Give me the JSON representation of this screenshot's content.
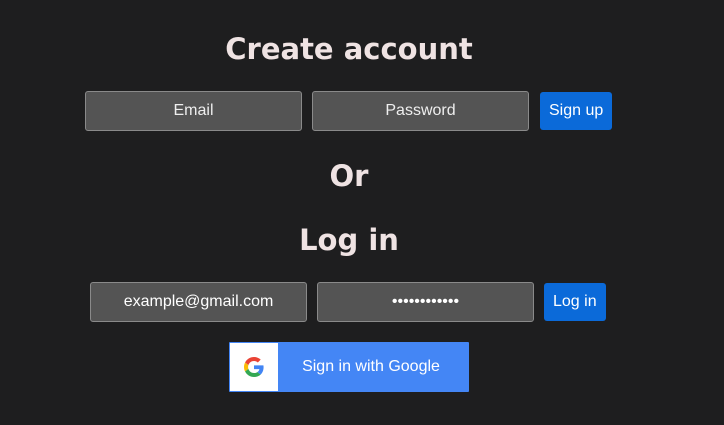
{
  "signup": {
    "title": "Create account",
    "email_placeholder": "Email",
    "password_placeholder": "Password",
    "button_label": "Sign up"
  },
  "separator": "Or",
  "login": {
    "title": "Log in",
    "email_value": "example@gmail.com",
    "password_value": "••••••••••••",
    "button_label": "Log in"
  },
  "google": {
    "label": "Sign in with Google",
    "icon": "google-g-icon",
    "brand_color": "#4486f5"
  },
  "colors": {
    "background": "#1e1e1f",
    "heading": "#efe3e3",
    "field_bg": "#545454",
    "primary_button": "#0b6ad9"
  }
}
